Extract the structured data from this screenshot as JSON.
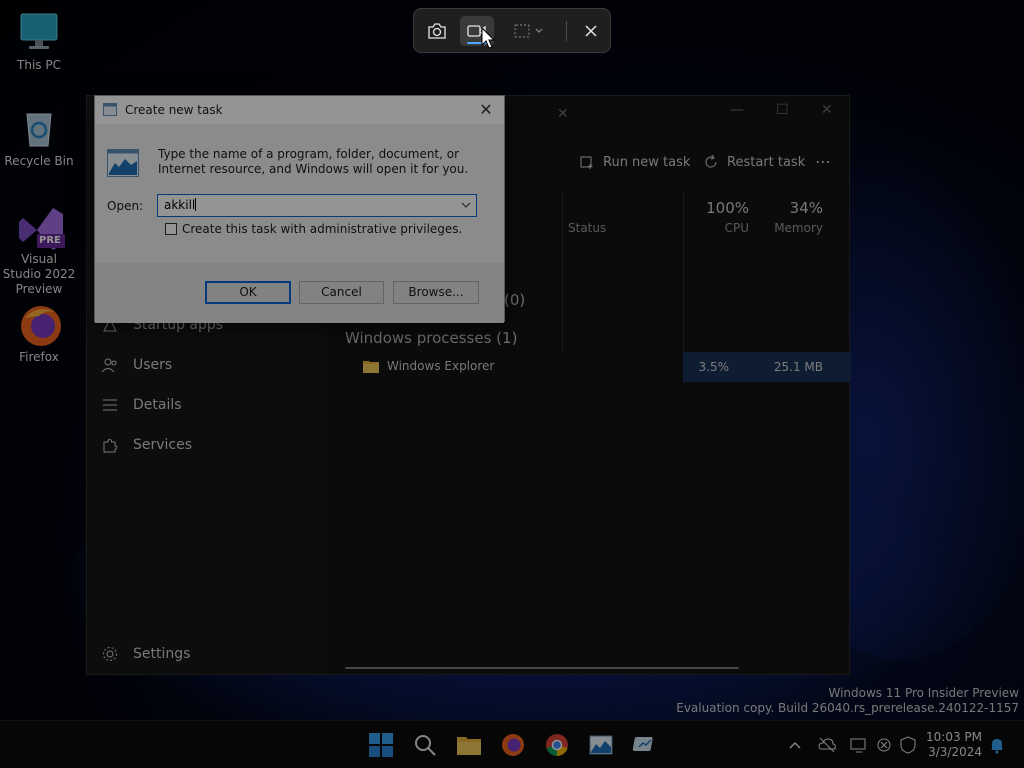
{
  "desktop": {
    "icons": [
      {
        "label": "This PC"
      },
      {
        "label": "Recycle Bin"
      },
      {
        "label": "Visual Studio 2022 Preview",
        "badge": "PRE"
      },
      {
        "label": "Firefox"
      }
    ]
  },
  "snip_toolbar": {
    "buttons": [
      "camera-icon",
      "video-record-icon",
      "rectangle-mode-icon",
      "close-icon"
    ]
  },
  "task_manager": {
    "toolbar": {
      "run_new_task": "Run new task",
      "restart_task": "Restart task",
      "more": "⋯"
    },
    "columns": {
      "status": "Status",
      "cpu_percent": "100%",
      "cpu": "CPU",
      "memory_percent": "34%",
      "memory": "Memory"
    },
    "sections": {
      "background_count": "(0)",
      "windows_processes": "Windows processes (1)"
    },
    "process": {
      "name": "Windows Explorer",
      "cpu": "3.5%",
      "memory": "25.1 MB"
    },
    "nav": {
      "startup_apps": "Startup apps",
      "users": "Users",
      "details": "Details",
      "services": "Services",
      "settings": "Settings"
    }
  },
  "dialog": {
    "title": "Create new task",
    "description": "Type the name of a program, folder, document, or Internet resource, and Windows will open it for you.",
    "open_label": "Open:",
    "open_value": "akkill",
    "admin_checkbox_label": "Create this task with administrative privileges.",
    "admin_checked": false,
    "ok": "OK",
    "cancel": "Cancel",
    "browse": "Browse..."
  },
  "watermark": {
    "line1": "Windows 11 Pro Insider Preview",
    "line2": "Evaluation copy. Build 26040.rs_prerelease.240122-1157"
  },
  "clock": {
    "time": "10:03 PM",
    "date": "3/3/2024"
  },
  "colors": {
    "accent": "#0a64d8",
    "selection": "#1a3358"
  }
}
